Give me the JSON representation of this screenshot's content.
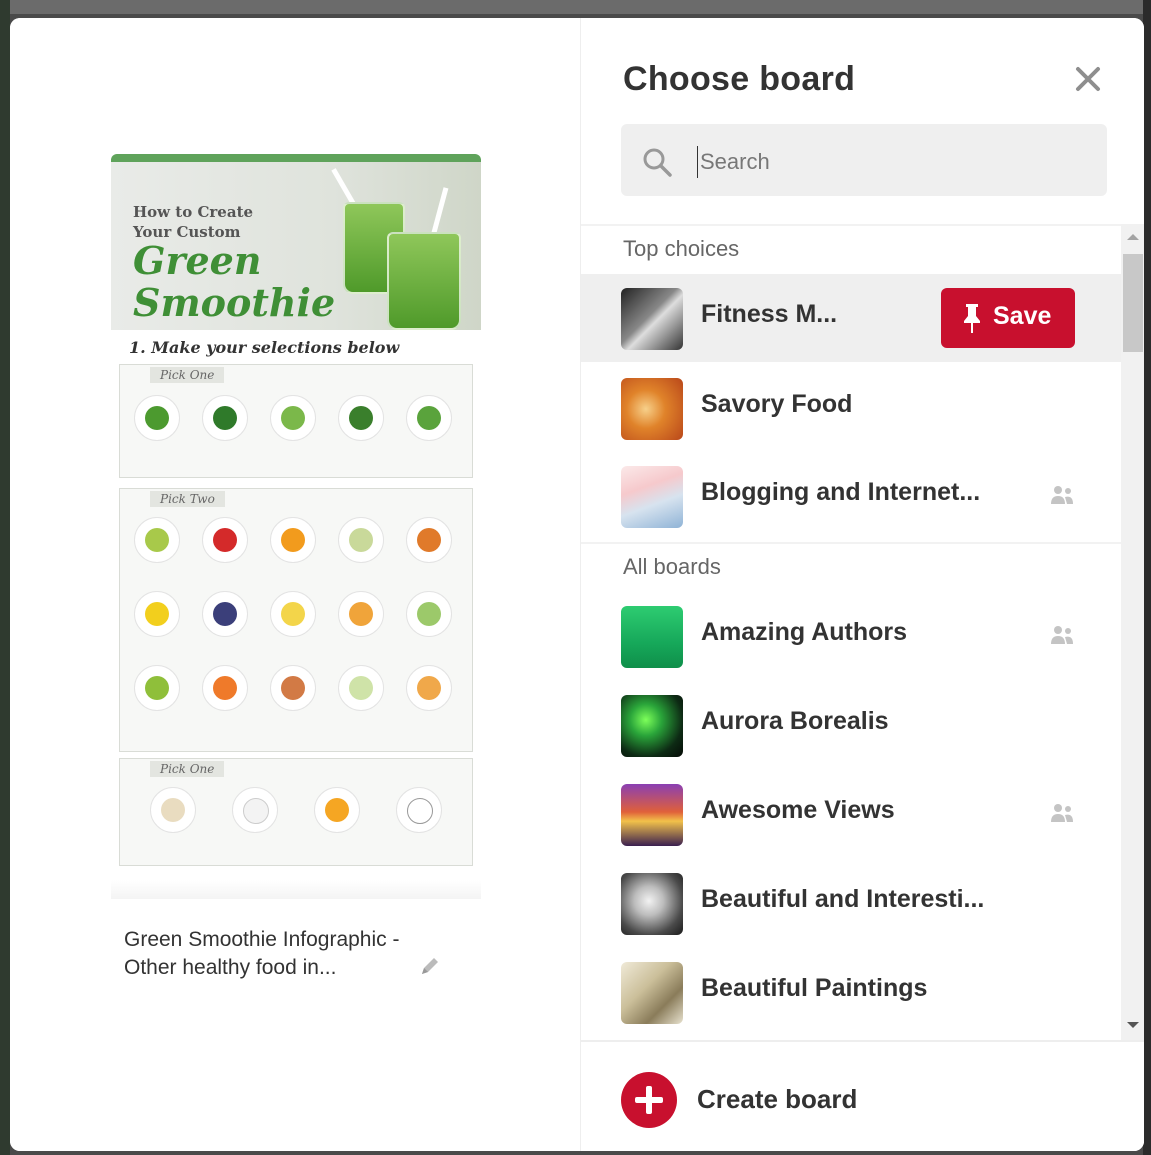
{
  "dialog": {
    "title": "Choose board",
    "close_icon": "close-icon"
  },
  "search": {
    "placeholder": "Search",
    "icon": "search-icon"
  },
  "pin": {
    "image_header": {
      "how_to": "How to Create\nYour Custom",
      "headline": "Green\nSmoothie"
    },
    "step_text": "1. Make your selections below",
    "section_tags": [
      "Pick One",
      "Pick Two",
      "Pick One"
    ],
    "description": "Green Smoothie Infographic - Other healthy food in...",
    "edit_icon": "pencil-icon"
  },
  "sections": {
    "top_choices_label": "Top choices",
    "all_boards_label": "All boards"
  },
  "top_choices": [
    {
      "name": "Fitness M...",
      "collaborative": false,
      "highlighted": true,
      "save_label": "Save"
    },
    {
      "name": "Savory Food",
      "collaborative": false
    },
    {
      "name": "Blogging and Internet...",
      "collaborative": true
    }
  ],
  "all_boards": [
    {
      "name": "Amazing Authors",
      "collaborative": true
    },
    {
      "name": "Aurora Borealis",
      "collaborative": false
    },
    {
      "name": "Awesome Views",
      "collaborative": true
    },
    {
      "name": "Beautiful and Interesti...",
      "collaborative": false
    },
    {
      "name": "Beautiful Paintings",
      "collaborative": false
    }
  ],
  "footer": {
    "create_label": "Create board"
  },
  "colors": {
    "accent": "#c8102e",
    "highlight_row": "#efefef",
    "search_bg": "#efefef"
  }
}
